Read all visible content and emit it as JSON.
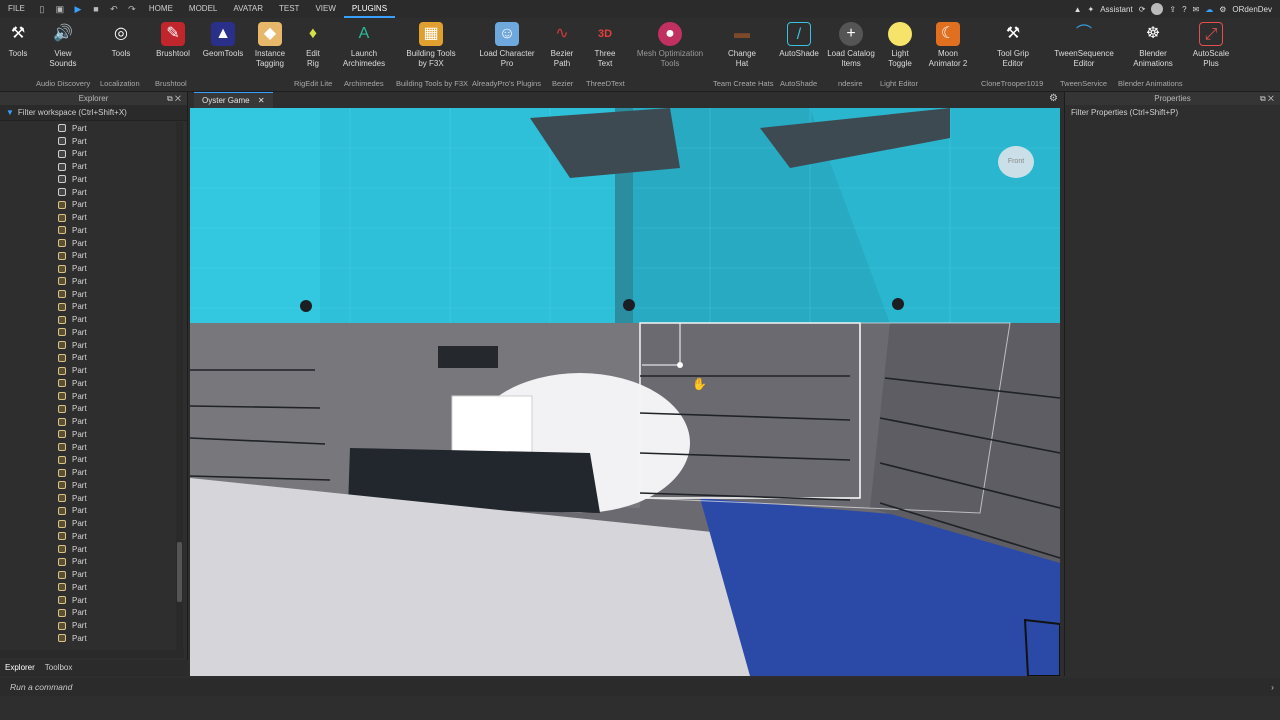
{
  "menu": {
    "items": [
      "FILE",
      "HOME",
      "MODEL",
      "AVATAR",
      "TEST",
      "VIEW",
      "PLUGINS"
    ],
    "active": "PLUGINS",
    "assistant_label": "Assistant",
    "user_name": "ORdenDev"
  },
  "ribbon": {
    "tools": [
      {
        "label": "Tools",
        "icon": "tools-icon"
      },
      {
        "label": "View Sounds",
        "icon": "speaker-icon"
      },
      {
        "label": "Tools",
        "icon": "brush-circle-icon"
      },
      {
        "label": "Brushtool",
        "icon": "brush-icon"
      },
      {
        "label": "GeomTools",
        "icon": "geom-icon"
      },
      {
        "label": "Instance Tagging",
        "icon": "tag-icon"
      },
      {
        "label": "Edit Rig",
        "icon": "rig-icon"
      },
      {
        "label": "Launch Archimedes",
        "icon": "archimedes-icon"
      },
      {
        "label": "Building Tools by F3X",
        "icon": "f3x-icon"
      },
      {
        "label": "Load Character Pro",
        "icon": "character-icon"
      },
      {
        "label": "Bezier Path",
        "icon": "bezier-icon"
      },
      {
        "label": "Three Text",
        "icon": "3d-text-icon"
      },
      {
        "label": "Mesh Optimization Tools",
        "icon": "mesh-icon"
      },
      {
        "label": "Change Hat",
        "icon": "hat-icon"
      },
      {
        "label": "AutoShade",
        "icon": "shade-icon"
      },
      {
        "label": "Load Catalog Items",
        "icon": "plus-icon"
      },
      {
        "label": "Light Toggle",
        "icon": "bulb-icon"
      },
      {
        "label": "Moon Animator 2",
        "icon": "moon-icon"
      },
      {
        "label": "Tool Grip Editor",
        "icon": "grip-icon"
      },
      {
        "label": "TweenSequence Editor",
        "icon": "tween-icon"
      },
      {
        "label": "Blender Animations",
        "icon": "blender-icon"
      },
      {
        "label": "AutoScale Plus",
        "icon": "autoscale-icon"
      }
    ],
    "groups": [
      {
        "label": "Audio Discovery"
      },
      {
        "label": "Localization"
      },
      {
        "label": "Brushtool"
      },
      {
        "label": "RigEdit Lite"
      },
      {
        "label": "Archimedes"
      },
      {
        "label": "Building Tools by F3X"
      },
      {
        "label": "AlreadyPro's Plugins"
      },
      {
        "label": "Bezier"
      },
      {
        "label": "ThreeDText"
      },
      {
        "label": "Team Create Hats"
      },
      {
        "label": "AutoShade"
      },
      {
        "label": "ndesire"
      },
      {
        "label": "Light Editor"
      },
      {
        "label": "CloneTrooper1019"
      },
      {
        "label": "TweenService"
      },
      {
        "label": "Blender Animations"
      }
    ]
  },
  "explorer": {
    "title": "Explorer",
    "filter_placeholder": "Filter workspace (Ctrl+Shift+X)",
    "item_label": "Part",
    "tabs": [
      "Explorer",
      "Toolbox"
    ]
  },
  "viewport": {
    "tab_label": "Oyster Game",
    "view_cube_label": "Front"
  },
  "properties": {
    "title": "Properties",
    "filter_placeholder": "Filter Properties (Ctrl+Shift+P)"
  },
  "command_bar": {
    "placeholder": "Run a command"
  }
}
